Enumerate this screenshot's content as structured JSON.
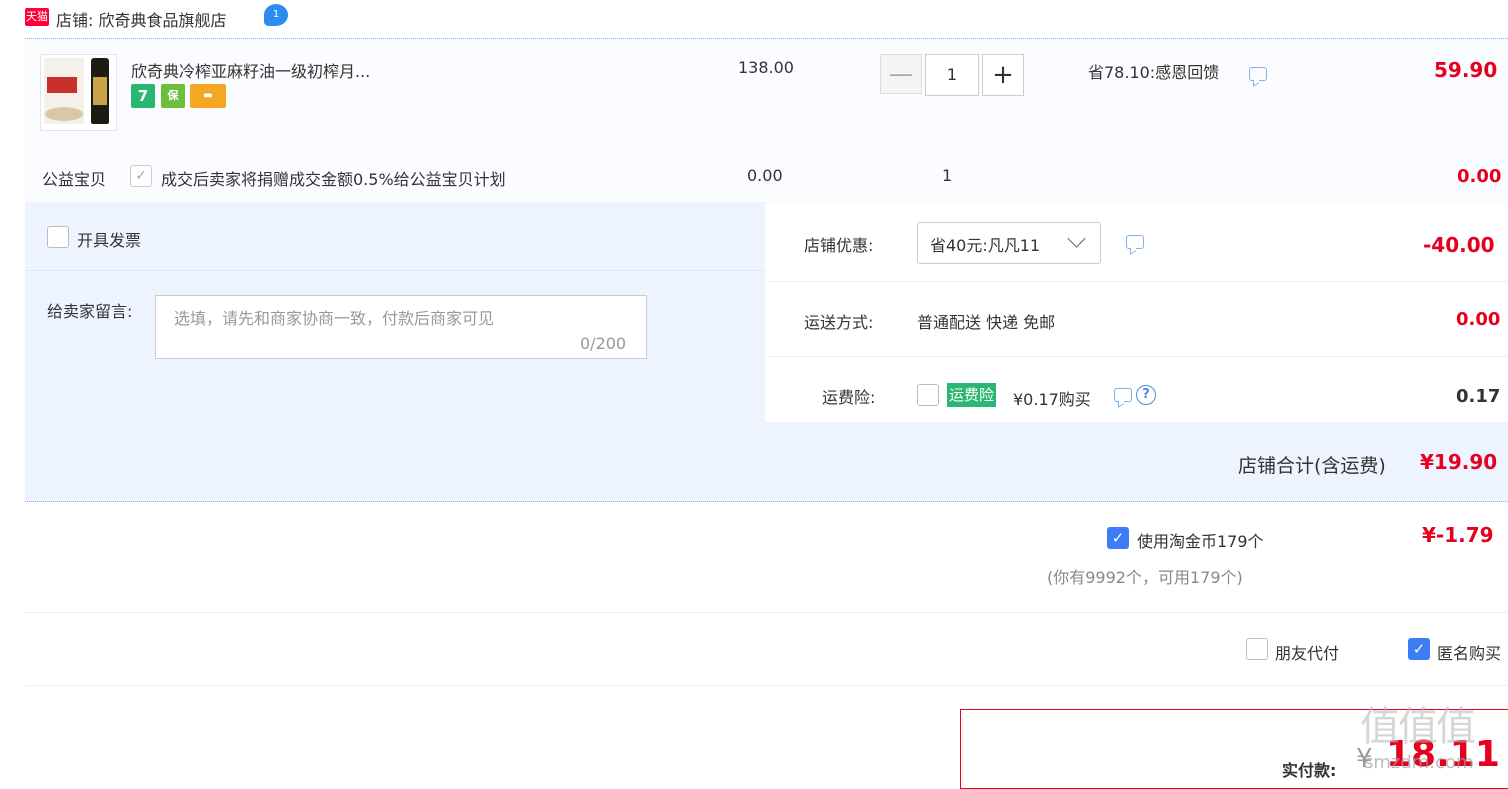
{
  "shop": {
    "logo_text": "天猫",
    "label": "店铺: 欣奇典食品旗舰店",
    "ww_icon": "wangwang-chat-icon"
  },
  "item": {
    "title": "欣奇典冷榨亚麻籽油一级初榨月...",
    "badge1": "7",
    "badge2": "保",
    "badge3": "▬",
    "price": "138.00",
    "quantity": "1",
    "minus": "—",
    "plus": "+",
    "promo": "省78.10:感恩回馈",
    "subtotal": "59.90"
  },
  "charity": {
    "label": "公益宝贝",
    "check": "✓",
    "text": "成交后卖家将捐赠成交金额0.5%给公益宝贝计划",
    "price": "0.00",
    "qty": "1",
    "total": "0.00"
  },
  "invoice": {
    "label": "开具发票"
  },
  "message": {
    "label": "给卖家留言:",
    "placeholder": "选填，请先和商家协商一致，付款后商家可见",
    "count": "0/200"
  },
  "discount": {
    "label": "店铺优惠:",
    "selected": "省40元:凡凡11",
    "amount": "-40.00"
  },
  "shipping": {
    "label": "运送方式:",
    "method": "普通配送 快递 免邮",
    "amount": "0.00"
  },
  "insurance": {
    "label": "运费险:",
    "badge": "运费险",
    "text": "¥0.17购买",
    "help": "?",
    "amount": "0.17"
  },
  "shop_total": {
    "label": "店铺合计(含运费)",
    "value": "¥19.90"
  },
  "coins": {
    "check": "✓",
    "label": "使用淘金币179个",
    "sub": "(你有9992个，可用179个)",
    "value": "¥-1.79"
  },
  "options": {
    "friend_pay": "朋友代付",
    "anonymous": "匿名购买",
    "anon_check": "✓"
  },
  "payment": {
    "label": "实付款:",
    "currency": "¥",
    "value": "18.11"
  },
  "watermark": {
    "main": "值值值",
    "sub": "smzdm.com"
  },
  "colors": {
    "accent_red": "#e4001e",
    "accent_blue": "#3c7cf4",
    "panel_bg": "#eef4ff",
    "badge_green": "#2cb673"
  }
}
